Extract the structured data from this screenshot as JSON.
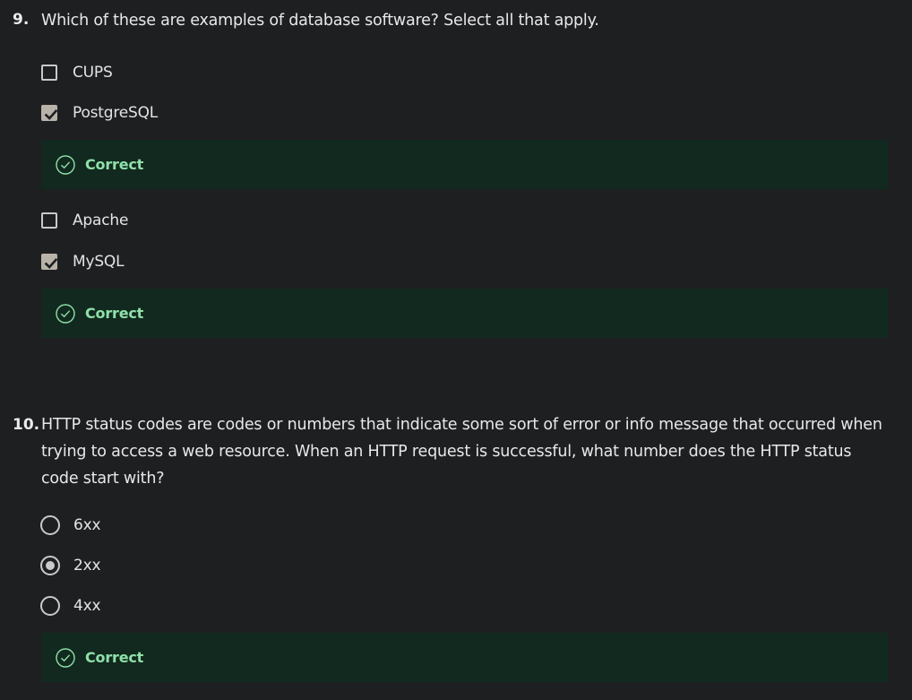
{
  "q9": {
    "number": "9.",
    "text": "Which of these are examples of database software? Select all that apply.",
    "options": [
      {
        "label": "CUPS",
        "checked": false
      },
      {
        "label": "PostgreSQL",
        "checked": true
      },
      {
        "label": "Apache",
        "checked": false
      },
      {
        "label": "MySQL",
        "checked": true
      }
    ],
    "feedback": [
      "Correct",
      "Correct"
    ]
  },
  "q10": {
    "number": "10.",
    "text": "HTTP status codes are codes or numbers that indicate some sort of error or info message that occurred when trying to access a web resource. When an HTTP request is successful, what number does the HTTP status code start with?",
    "options": [
      {
        "label": "6xx",
        "selected": false
      },
      {
        "label": "2xx",
        "selected": true
      },
      {
        "label": "4xx",
        "selected": false
      }
    ],
    "feedback": "Correct"
  },
  "colors": {
    "background": "#1e1f21",
    "feedback_bg": "#12291f",
    "correct_text": "#8fe0a9",
    "checked_fill": "#b8b2a9"
  },
  "icons": {
    "correct": "check-circle-icon",
    "checkbox_checked": "checkmark-icon"
  }
}
